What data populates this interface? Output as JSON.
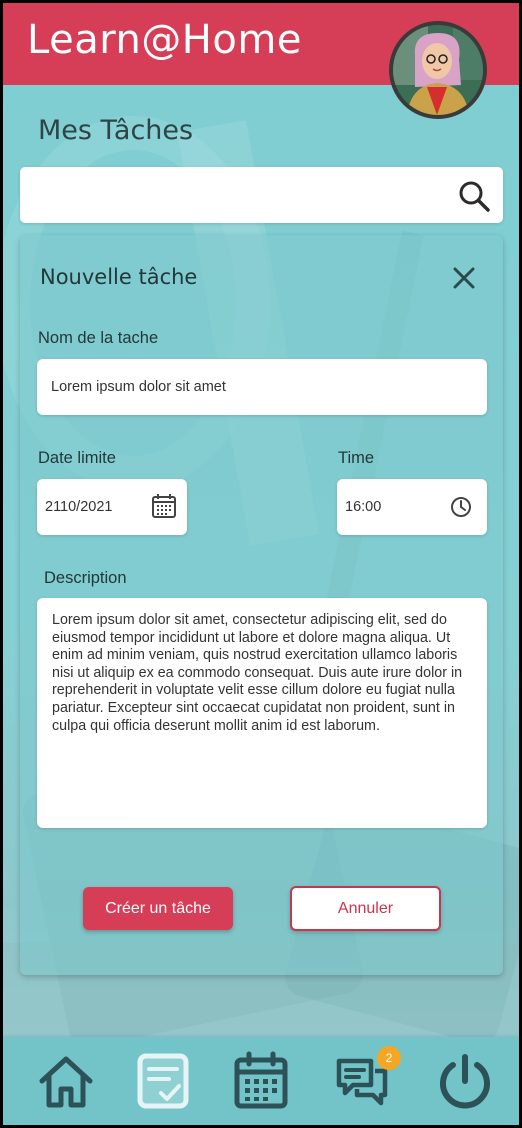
{
  "app": {
    "title": "Learn@Home"
  },
  "page": {
    "title": "Mes Tâches"
  },
  "search": {
    "value": "",
    "placeholder": ""
  },
  "form": {
    "title": "Nouvelle tâche",
    "task_name": {
      "label": "Nom de la tache",
      "value": "Lorem ipsum dolor sit amet"
    },
    "date": {
      "label": "Date limite",
      "value": "2110/2021"
    },
    "time": {
      "label": "Time",
      "value": "16:00"
    },
    "description": {
      "label": "Description",
      "value": "Lorem ipsum dolor sit amet, consectetur adipiscing elit, sed do eiusmod tempor incididunt ut labore et dolore magna aliqua. Ut enim ad minim veniam, quis nostrud exercitation ullamco laboris nisi ut aliquip ex ea commodo consequat. Duis aute irure dolor in reprehenderit in voluptate velit esse cillum dolore eu fugiat nulla pariatur. Excepteur sint occaecat cupidatat non proident, sunt in culpa qui officia deserunt mollit anim id est laborum."
    },
    "create_label": "Créer un tâche",
    "cancel_label": "Annuler"
  },
  "nav": {
    "items": [
      {
        "icon": "home-icon"
      },
      {
        "icon": "tasks-icon",
        "active": true
      },
      {
        "icon": "calendar-icon"
      },
      {
        "icon": "chat-icon"
      },
      {
        "icon": "power-icon"
      }
    ],
    "chat_badge": "2"
  },
  "colors": {
    "brand": "#d63d56",
    "background": "#7ecdd1",
    "nav": "#72c4c9",
    "icon": "#2c5258",
    "badge": "#f5a623"
  }
}
